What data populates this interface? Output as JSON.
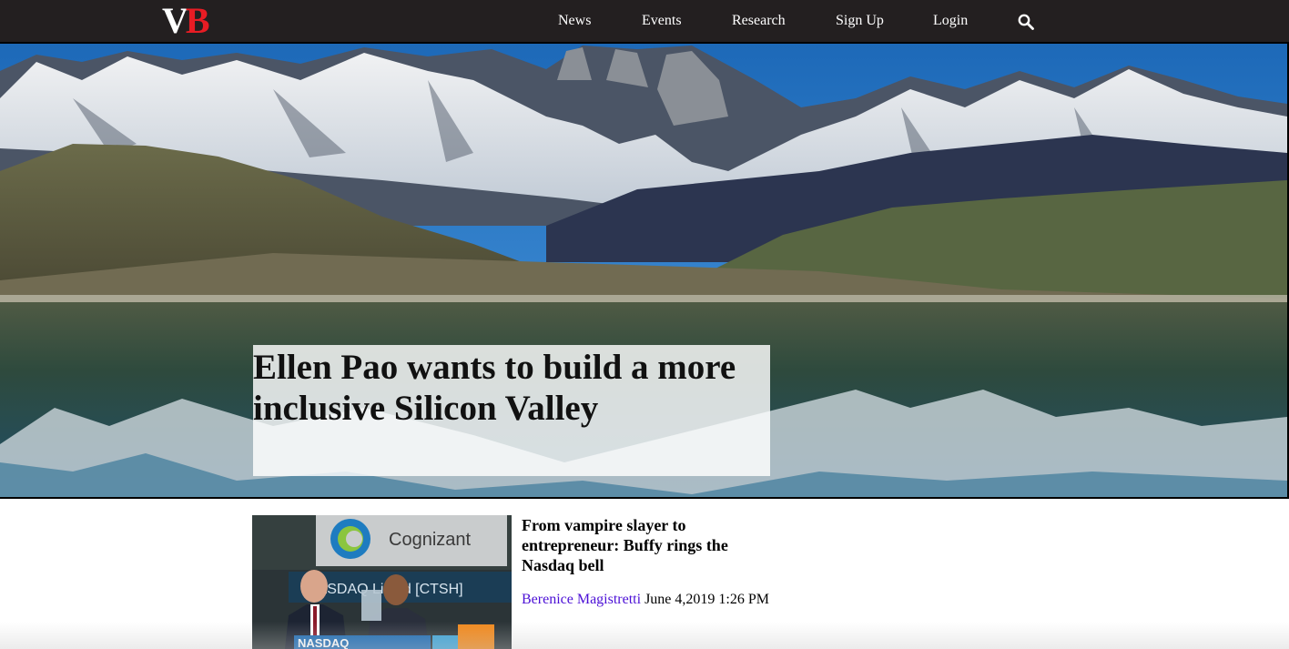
{
  "header": {
    "logo_v": "V",
    "logo_b": "B",
    "nav": [
      {
        "label": "News"
      },
      {
        "label": "Events"
      },
      {
        "label": "Research"
      },
      {
        "label": "Sign Up"
      },
      {
        "label": "Login"
      }
    ],
    "search_icon": "search-icon"
  },
  "hero": {
    "headline": "Ellen Pao wants to build a more inclusive Silicon Valley"
  },
  "article": {
    "title": "From vampire slayer to entrepreneur: Buffy rings the Nasdaq bell",
    "author": "Berenice Magistretti",
    "date": "June 4,2019 1:26 PM",
    "thumb_brand": "Cognizant",
    "thumb_ticker": "NASDAQ Listed [CTSH]",
    "thumb_bottom": "NASDAQ"
  },
  "colors": {
    "topbar": "#231f20",
    "logo_red": "#e81c24",
    "author_link": "#4b0fd6"
  }
}
